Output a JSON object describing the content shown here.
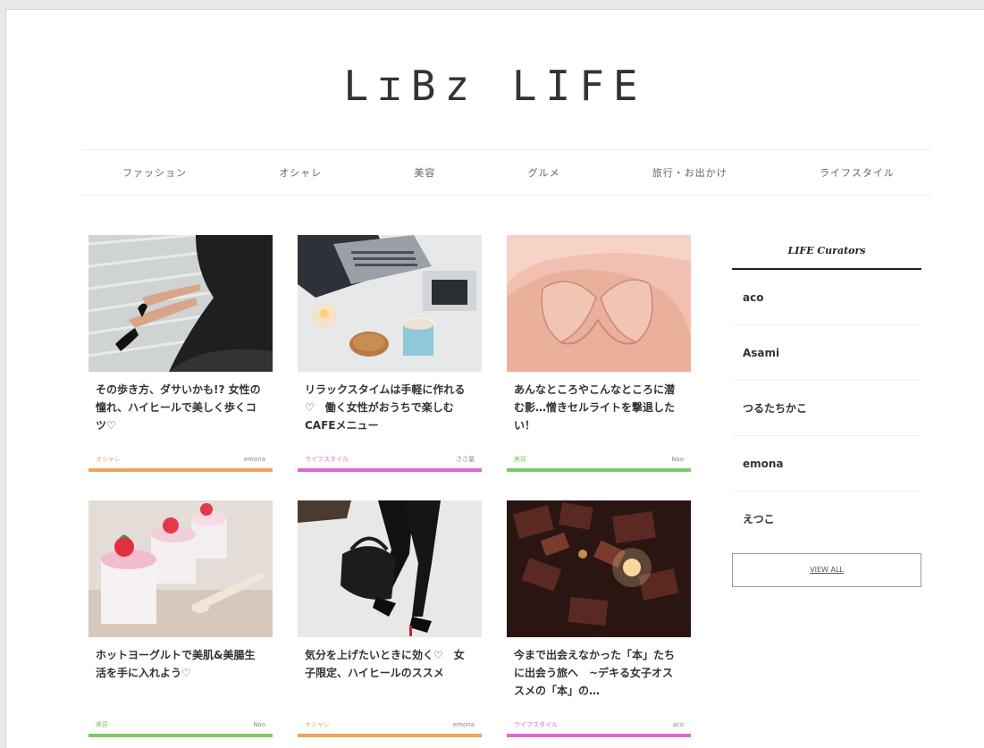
{
  "logo": "LɪBz LIFE",
  "nav": [
    "ファッション",
    "オシャレ",
    "美容",
    "グルメ",
    "旅行・お出かけ",
    "ライフスタイル"
  ],
  "colors": {
    "fashion": "#f0a35a",
    "lifestyle": "#dc6ad2",
    "beauty": "#7ccb63",
    "gourmet": "#7ccb63"
  },
  "articles": [
    {
      "title": "その歩き方、ダサいかも!? 女性の憧れ、ハイヒールで美しく歩くコツ♡",
      "category": "オシャレ",
      "author": "emona",
      "color": "#f0a35a"
    },
    {
      "title": "リラックスタイムは手軽に作れる♡　働く女性がおうちで楽しむCAFEメニュー",
      "category": "ライフスタイル",
      "author": "ささ葉",
      "color": "#dc6ad2"
    },
    {
      "title": "あんなところやこんなところに潜む影…憎きセルライトを撃退したい！",
      "category": "美容",
      "author": "Nao",
      "color": "#7ccb63"
    },
    {
      "title": "ホットヨーグルトで美肌&美腸生活を手に入れよう♡",
      "category": "美容",
      "author": "Nao",
      "color": "#7ccb63"
    },
    {
      "title": "気分を上げたいときに効く♡　女子限定、ハイヒールのススメ",
      "category": "オシャレ",
      "author": "emona",
      "color": "#f0a35a"
    },
    {
      "title": "今まで出会えなかった「本」たちに出会う旅へ　~デキる女子オススメの「本」の…",
      "category": "ライフスタイル",
      "author": "aco",
      "color": "#dc6ad2"
    }
  ],
  "sidebar": {
    "heading": "LIFE Curators",
    "curators": [
      "aco",
      "Asami",
      "つるたちかこ",
      "emona",
      "えつこ"
    ],
    "view_all": "VIEW ALL"
  }
}
